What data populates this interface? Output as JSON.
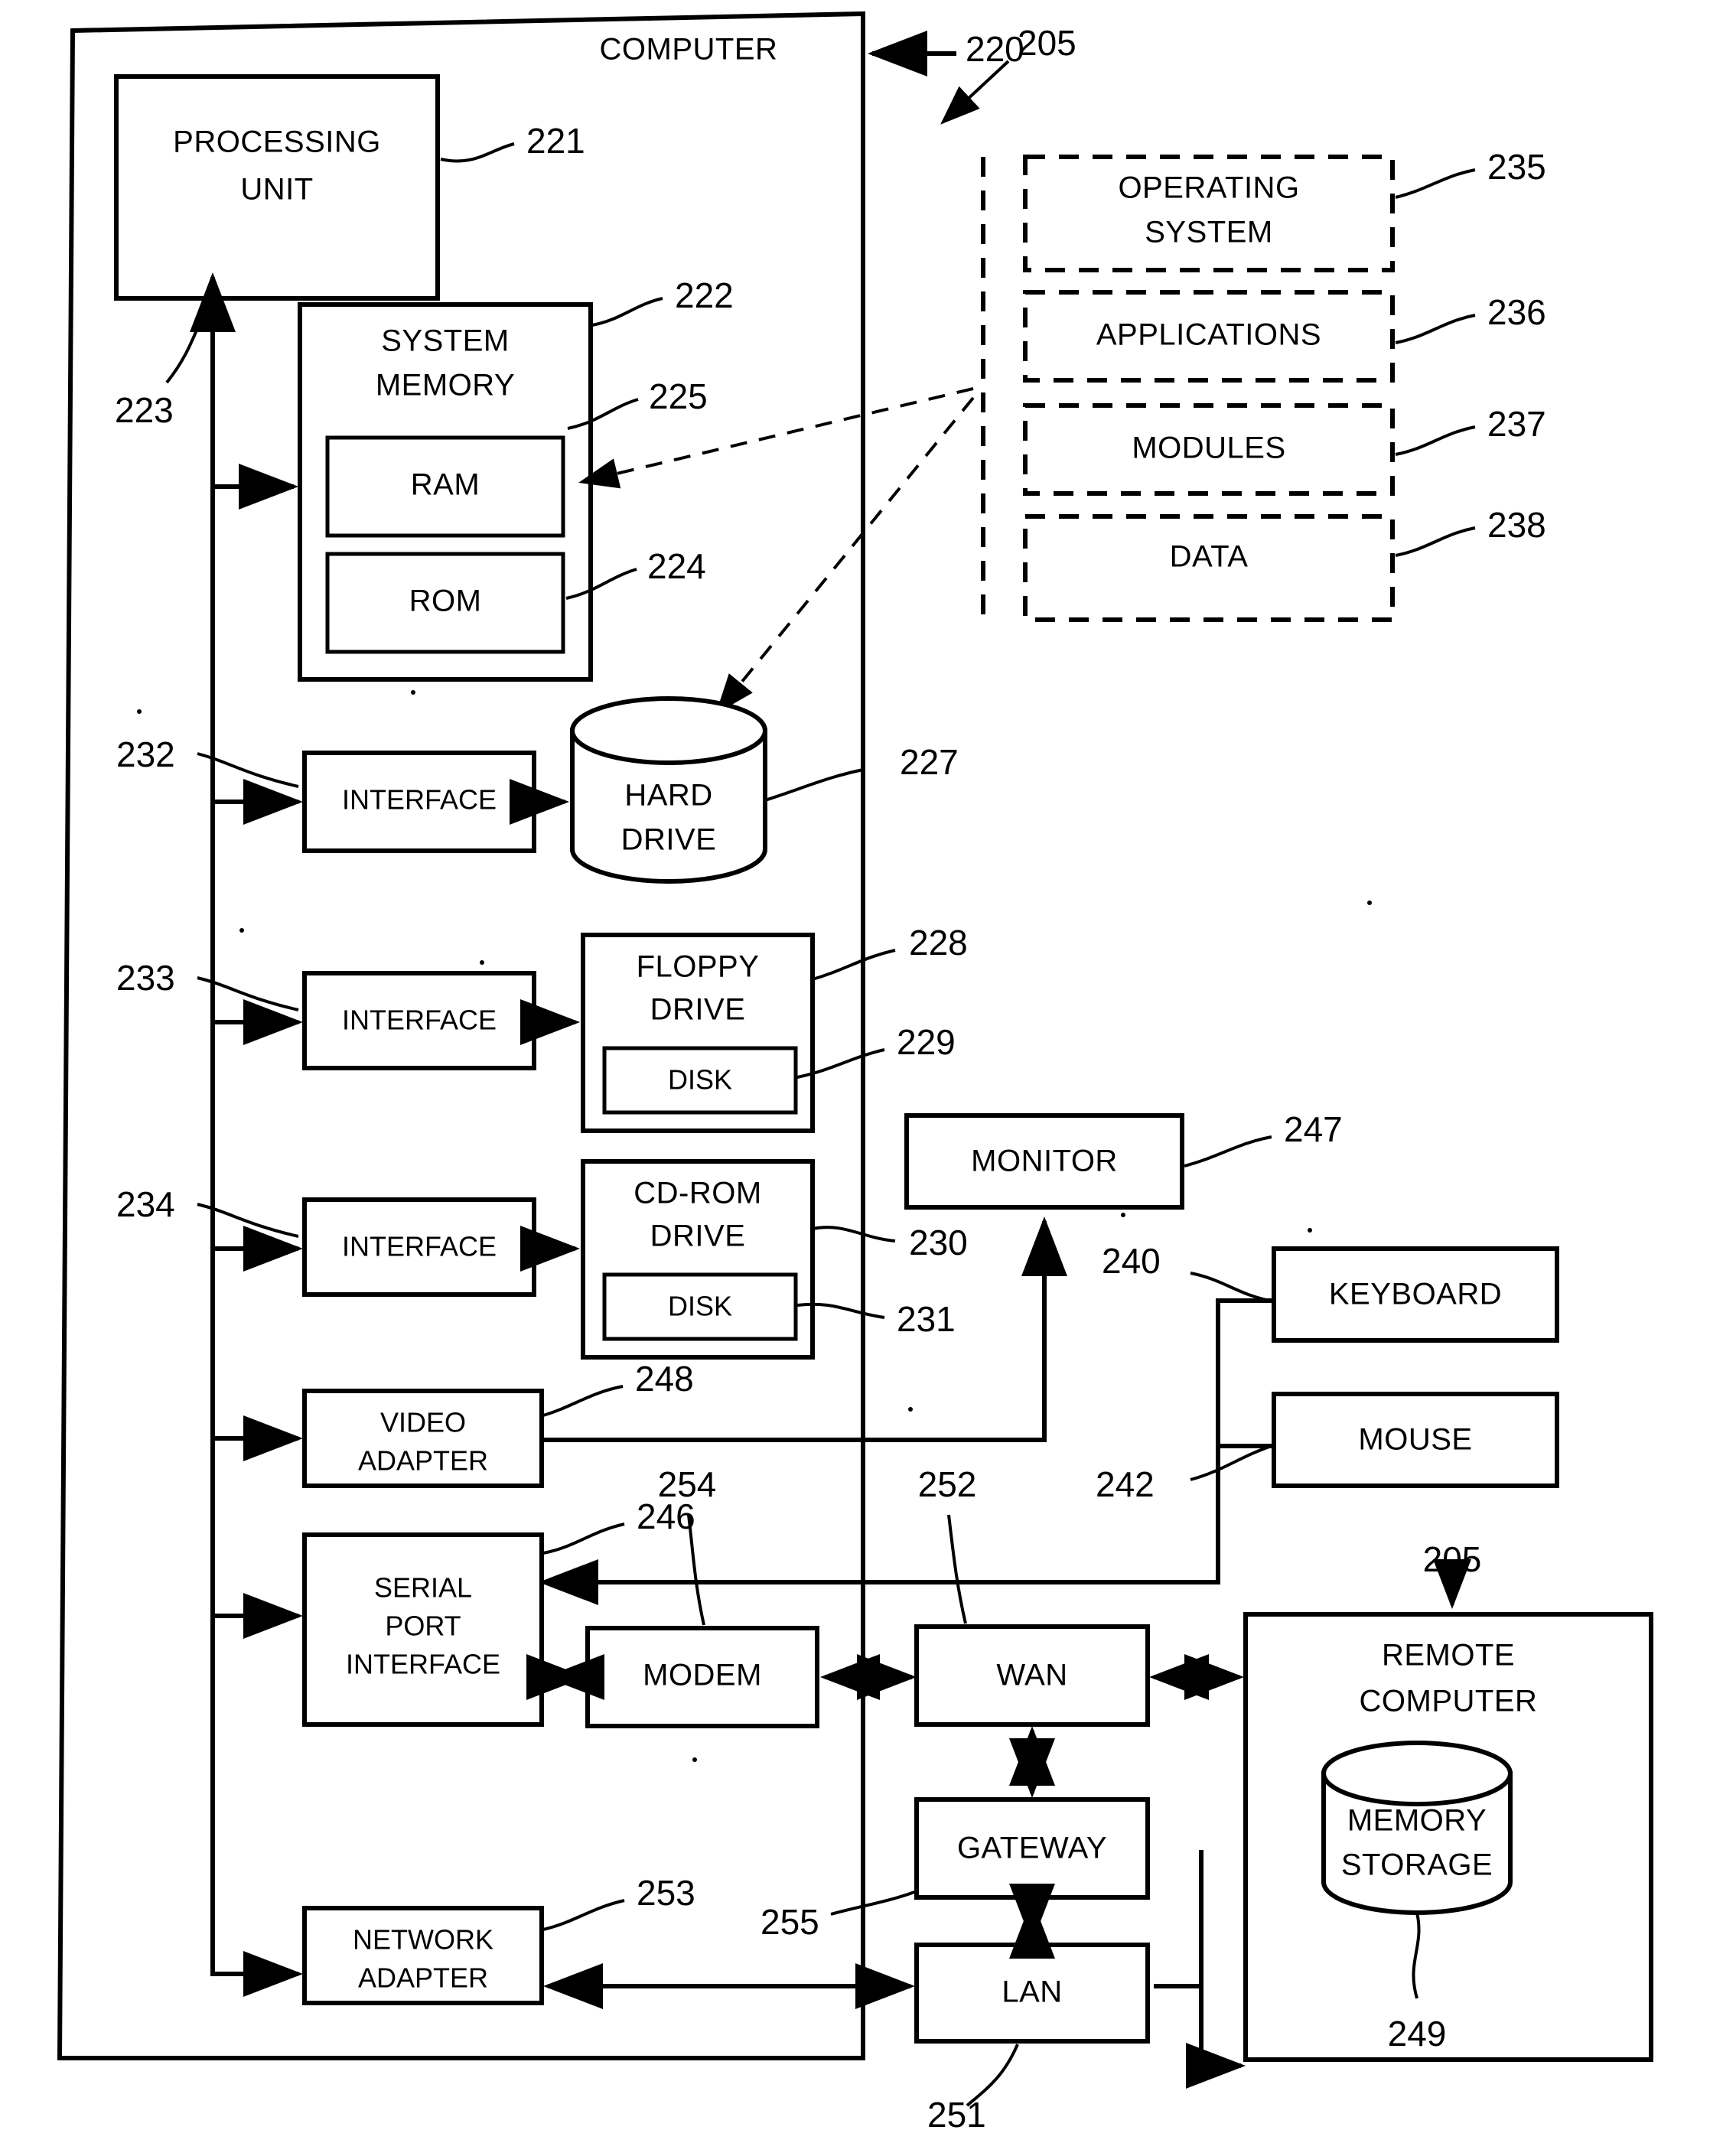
{
  "figure": {
    "title": "COMPUTER",
    "kind": "patent-block-diagram"
  },
  "host_computer": {
    "enclosure_label": "COMPUTER",
    "enclosure_ref": "220",
    "system_ref": "205",
    "bus_ref": "223"
  },
  "blocks": {
    "processing_unit": {
      "label_line1": "PROCESSING",
      "label_line2": "UNIT",
      "ref": "221"
    },
    "system_memory": {
      "label_line1": "SYSTEM",
      "label_line2": "MEMORY",
      "ref": "222"
    },
    "ram": {
      "label": "RAM",
      "ref": "225"
    },
    "rom": {
      "label": "ROM",
      "ref": "224"
    },
    "interface_hdd": {
      "label": "INTERFACE",
      "ref": "232"
    },
    "hard_drive": {
      "label_line1": "HARD",
      "label_line2": "DRIVE",
      "ref": "227"
    },
    "interface_floppy": {
      "label": "INTERFACE",
      "ref": "233"
    },
    "floppy_drive": {
      "label_line1": "FLOPPY",
      "label_line2": "DRIVE",
      "ref": "228"
    },
    "floppy_disk": {
      "label": "DISK",
      "ref": "229"
    },
    "interface_cdrom": {
      "label": "INTERFACE",
      "ref": "234"
    },
    "cdrom_drive": {
      "label_line1": "CD-ROM",
      "label_line2": "DRIVE",
      "ref": "230"
    },
    "cdrom_disk": {
      "label": "DISK",
      "ref": "231"
    },
    "video_adapter": {
      "label_line1": "VIDEO",
      "label_line2": "ADAPTER",
      "ref": "248"
    },
    "serial_port_interface": {
      "label_line1": "SERIAL",
      "label_line2": "PORT",
      "label_line3": "INTERFACE",
      "ref": "246"
    },
    "network_adapter": {
      "label_line1": "NETWORK",
      "label_line2": "ADAPTER",
      "ref": "253"
    },
    "modem": {
      "label": "MODEM",
      "ref": "254"
    },
    "monitor": {
      "label": "MONITOR",
      "ref": "247"
    },
    "keyboard": {
      "label": "KEYBOARD",
      "ref": "240"
    },
    "mouse": {
      "label": "MOUSE",
      "ref": "242"
    },
    "wan": {
      "label": "WAN",
      "ref": "252"
    },
    "gateway": {
      "label": "GATEWAY",
      "ref": "255"
    },
    "lan": {
      "label": "LAN",
      "ref": "251"
    },
    "remote_computer": {
      "label_line1": "REMOTE",
      "label_line2": "COMPUTER",
      "ref": "205"
    },
    "memory_storage": {
      "label_line1": "MEMORY",
      "label_line2": "STORAGE",
      "ref": "249"
    }
  },
  "software_modules": [
    {
      "label_line1": "OPERATING",
      "label_line2": "SYSTEM",
      "ref": "235"
    },
    {
      "label_line1": "APPLICATIONS",
      "label_line2": "",
      "ref": "236"
    },
    {
      "label_line1": "MODULES",
      "label_line2": "",
      "ref": "237"
    },
    {
      "label_line1": "DATA",
      "label_line2": "",
      "ref": "238"
    }
  ],
  "reference_numerals": {
    "n205_top": "205",
    "n205_remote": "205",
    "n220": "220",
    "n221": "221",
    "n222": "222",
    "n223": "223",
    "n224": "224",
    "n225": "225",
    "n227": "227",
    "n228": "228",
    "n229": "229",
    "n230": "230",
    "n231": "231",
    "n232": "232",
    "n233": "233",
    "n234": "234",
    "n235": "235",
    "n236": "236",
    "n237": "237",
    "n238": "238",
    "n240": "240",
    "n242": "242",
    "n246": "246",
    "n247": "247",
    "n248": "248",
    "n249": "249",
    "n251": "251",
    "n252": "252",
    "n253": "253",
    "n254": "254",
    "n255": "255"
  },
  "colors": {
    "ink": "#000000",
    "paper": "#ffffff"
  }
}
